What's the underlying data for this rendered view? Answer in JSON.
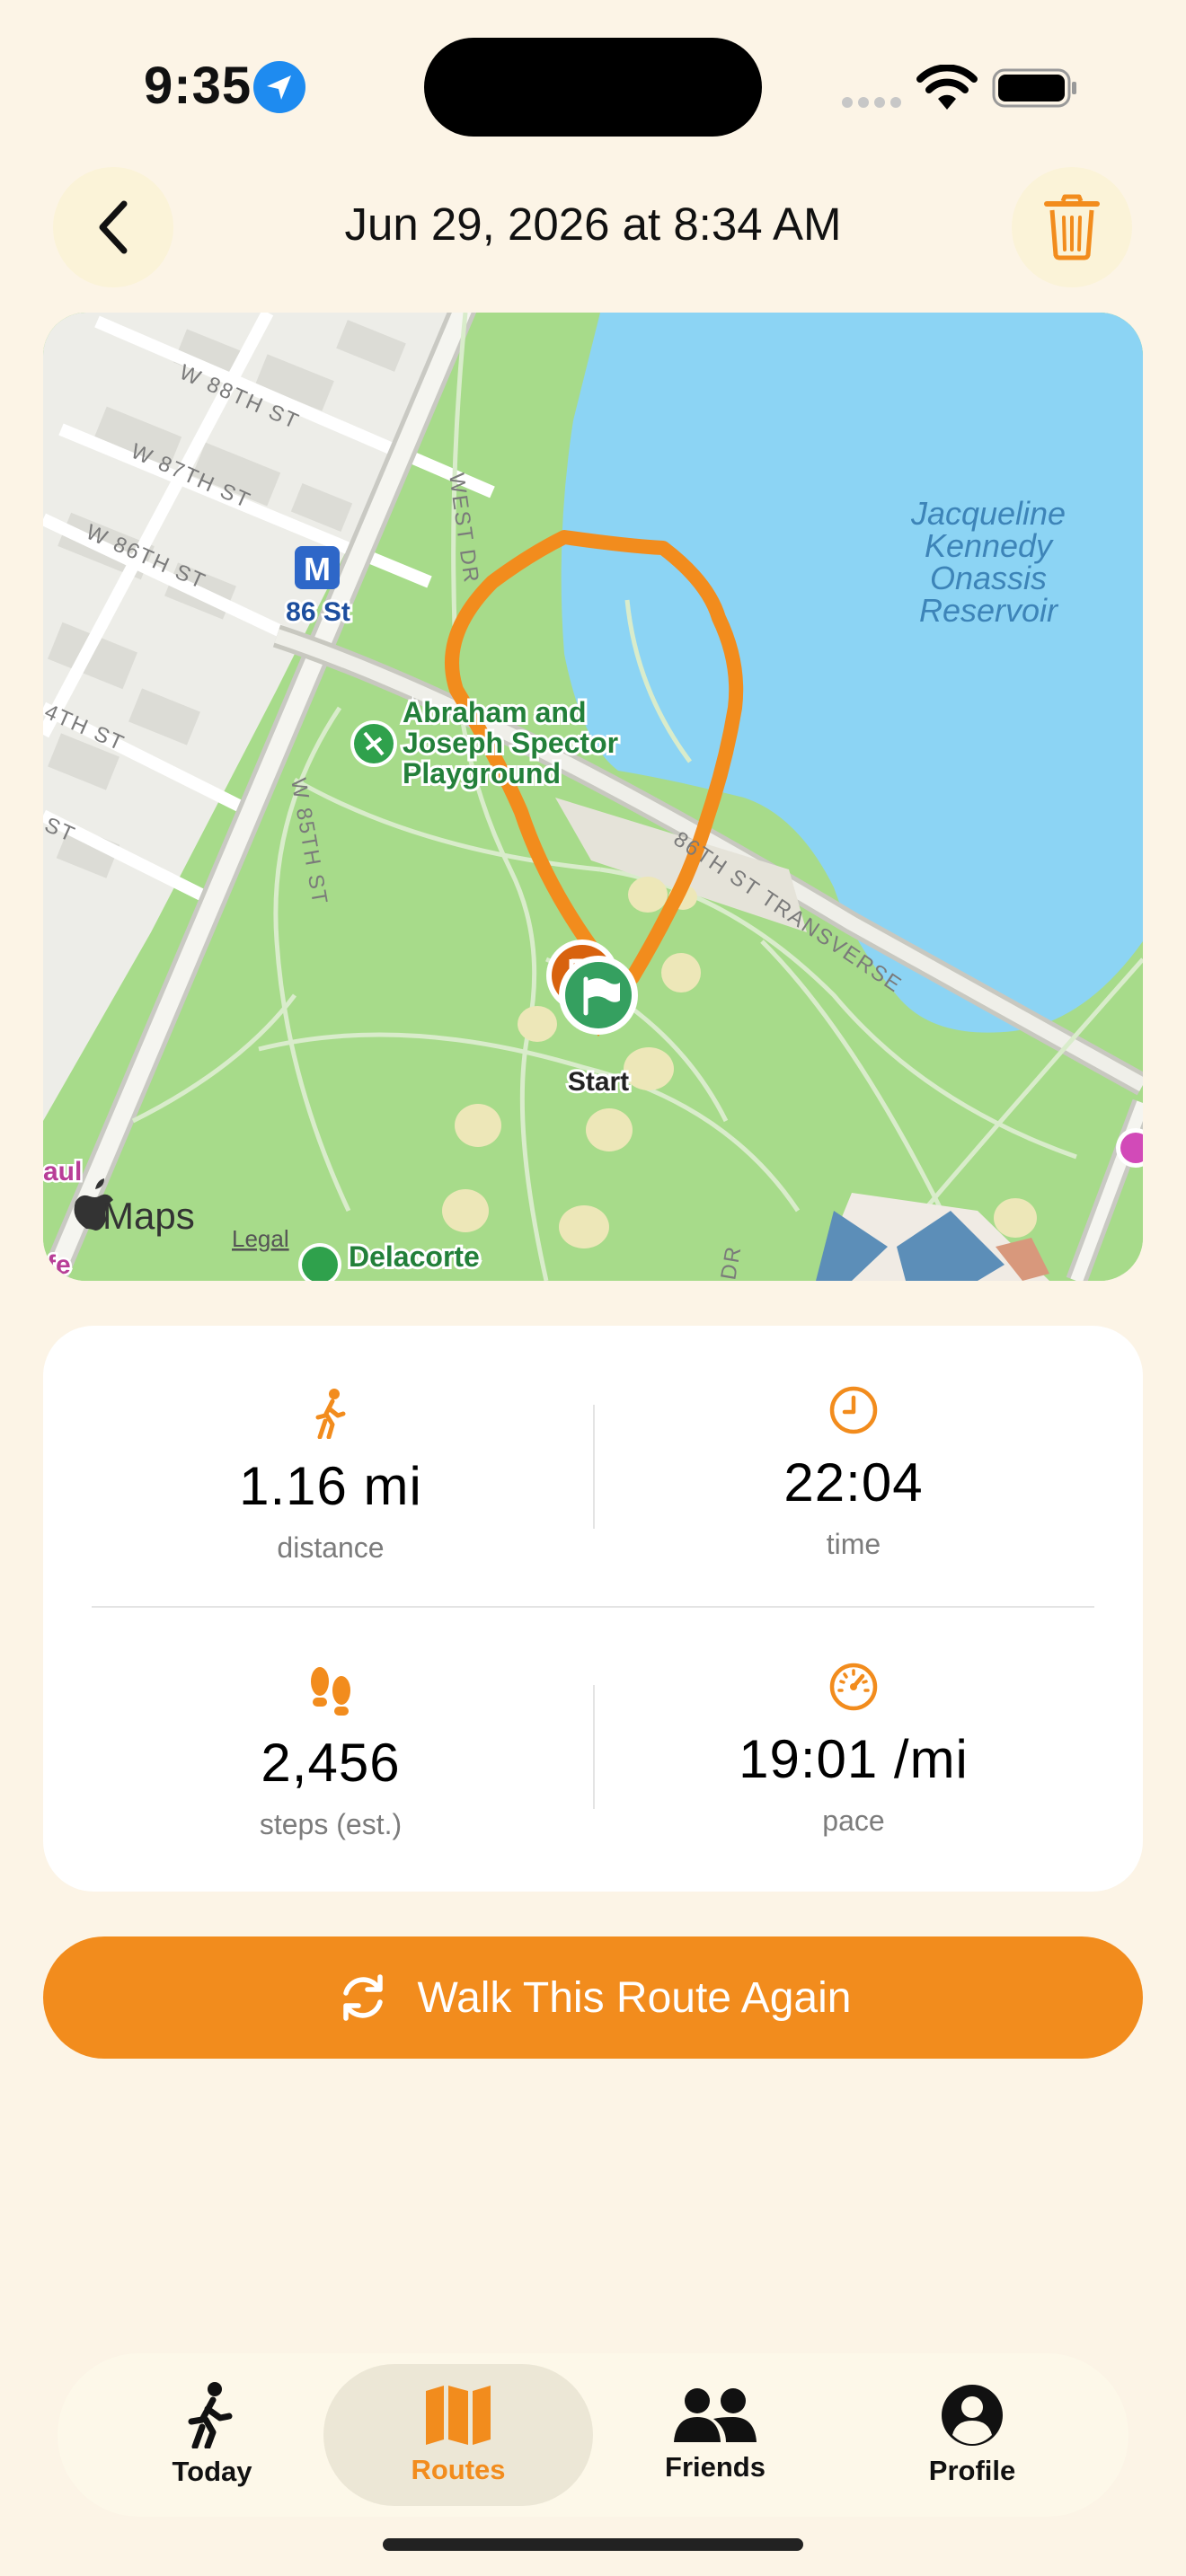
{
  "status_bar": {
    "time": "9:35"
  },
  "header": {
    "title": "Jun 29, 2026 at 8:34 AM"
  },
  "map": {
    "labels": {
      "street_w88": "W 88TH ST",
      "street_w87": "W 87TH ST",
      "street_w86": "W 86TH ST",
      "street_w85": "W 85TH ST",
      "street_4th": "4TH ST",
      "street_st": "ST",
      "west_dr": "WEST DR",
      "transverse": "86TH ST TRANSVERSE",
      "subway_letter": "M",
      "subway_station": "86 St",
      "playground_1": "Abraham and",
      "playground_2": "Joseph Spector",
      "playground_3": "Playground",
      "reservoir_1": "Jacqueline",
      "reservoir_2": "Kennedy",
      "reservoir_3": "Onassis",
      "reservoir_4": "Reservoir",
      "start": "Start",
      "theater": "Delacorte",
      "aul": "aul",
      "fe": "fe",
      "maps_brand": "Maps",
      "legal": "Legal",
      "dr": "DR"
    },
    "route_color": "#F28C1D",
    "water_color": "#8CD4F4",
    "park_color": "#A7DB8A"
  },
  "stats": {
    "distance": {
      "value": "1.16 mi",
      "label": "distance",
      "icon": "walking-person-icon"
    },
    "time": {
      "value": "22:04",
      "label": "time",
      "icon": "clock-icon"
    },
    "steps": {
      "value": "2,456",
      "label": "steps (est.)",
      "icon": "footprints-icon"
    },
    "pace": {
      "value": "19:01 /mi",
      "label": "pace",
      "icon": "speedometer-icon"
    }
  },
  "actions": {
    "walk_again_label": "Walk This Route Again"
  },
  "tabs": [
    {
      "label": "Today",
      "icon": "walking-person-icon"
    },
    {
      "label": "Routes",
      "icon": "map-icon",
      "active": true
    },
    {
      "label": "Friends",
      "icon": "people-icon"
    },
    {
      "label": "Profile",
      "icon": "person-circle-icon"
    }
  ],
  "colors": {
    "accent": "#F28C1D",
    "background": "#FCF4E6"
  }
}
